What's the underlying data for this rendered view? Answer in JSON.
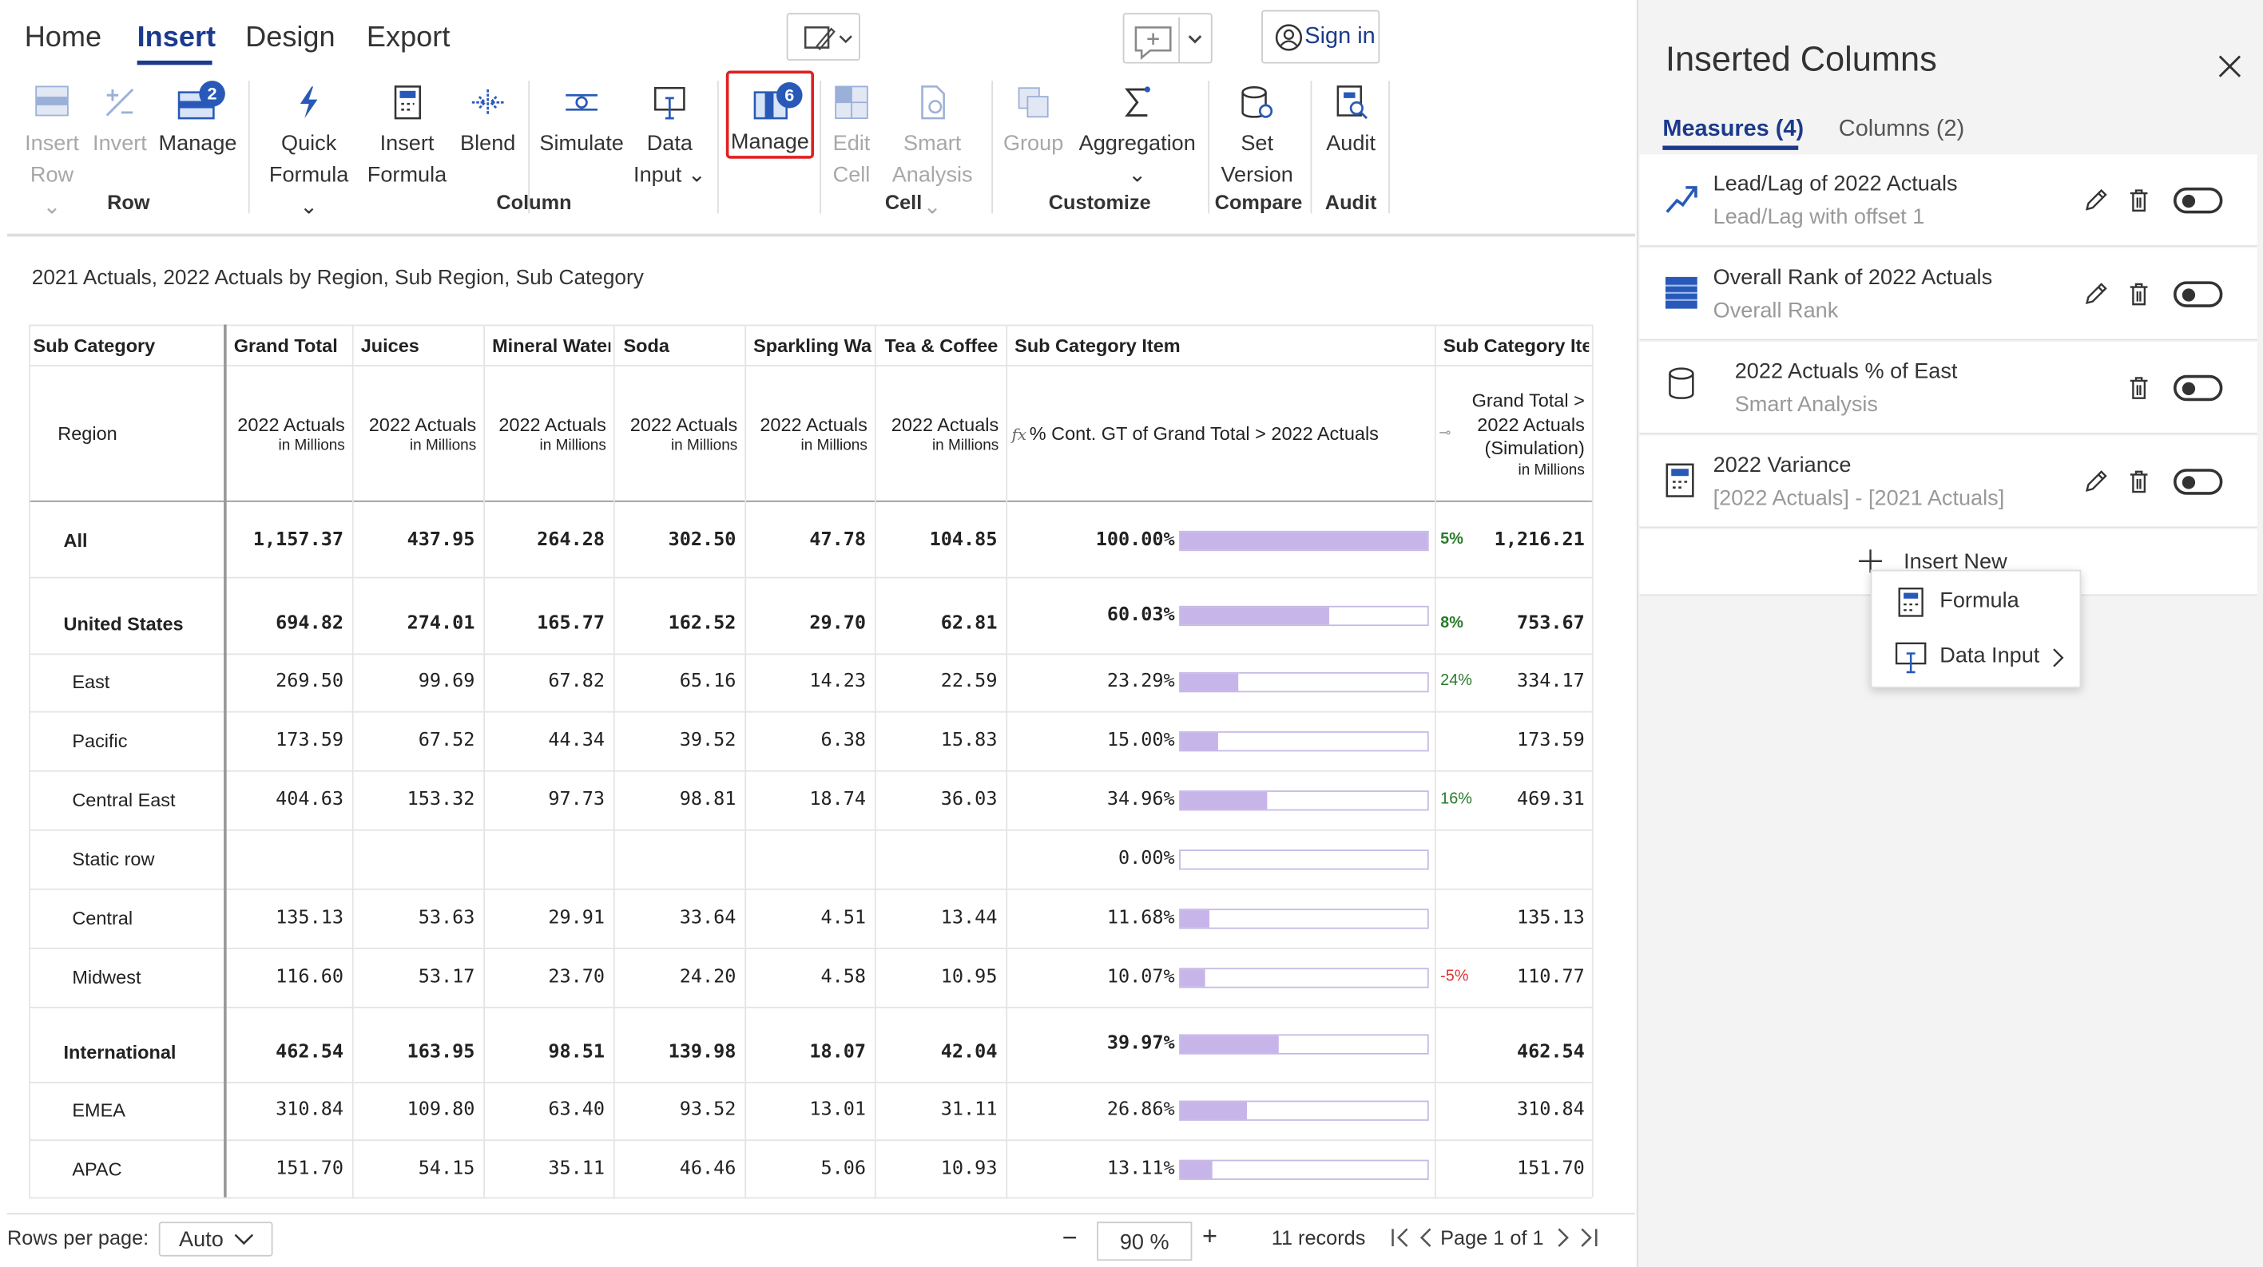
{
  "tabs": [
    "Home",
    "Insert",
    "Design",
    "Export"
  ],
  "sign_in": "Sign in",
  "ribbon": {
    "insert_row": [
      "Insert",
      "Row"
    ],
    "invert": "Invert",
    "manage_row": "Manage",
    "manage_row_badge": "2",
    "quick_formula": [
      "Quick",
      "Formula"
    ],
    "insert_formula": [
      "Insert",
      "Formula"
    ],
    "blend": "Blend",
    "simulate": "Simulate",
    "data_input": [
      "Data",
      "Input"
    ],
    "manage_col": "Manage",
    "manage_col_badge": "6",
    "edit_cell": [
      "Edit",
      "Cell"
    ],
    "smart_analysis": [
      "Smart",
      "Analysis"
    ],
    "group": "Group",
    "aggregation": "Aggregation",
    "set_version": [
      "Set",
      "Version"
    ],
    "audit": "Audit",
    "groups": {
      "row": "Row",
      "column": "Column",
      "cell": "Cell",
      "customize": "Customize",
      "compare": "Compare",
      "audit": "Audit"
    }
  },
  "report_title": "2021 Actuals, 2022 Actuals by Region, Sub Region, Sub Category",
  "table": {
    "col_headers": [
      "Sub Category",
      "Grand Total",
      "Juices",
      "Mineral Water",
      "Soda",
      "Sparkling Wat",
      "Tea & Coffee",
      "Sub Category Item",
      "Sub Category Ite"
    ],
    "region_label": "Region",
    "measure": "2022 Actuals",
    "unit": "in Millions",
    "pct_header": "% Cont. GT of Grand Total > 2022 Actuals",
    "sim_header": [
      "Grand Total >",
      "2022 Actuals",
      "(Simulation)",
      "in Millions"
    ],
    "rows": [
      {
        "label": "All",
        "bold": true,
        "v": [
          "1,157.37",
          "437.95",
          "264.28",
          "302.50",
          "47.78",
          "104.85"
        ],
        "pct": "100.00%",
        "fill": 1.0,
        "delta": "5%",
        "dc": "#2a7a2a",
        "sim": "1,216.21"
      },
      {
        "label": "United States",
        "bold": true,
        "v": [
          "694.82",
          "274.01",
          "165.77",
          "162.52",
          "29.70",
          "62.81"
        ],
        "pct": "60.03%",
        "fill": 0.6003,
        "delta": "8%",
        "dc": "#2a7a2a",
        "sim": "753.67"
      },
      {
        "label": "East",
        "bold": false,
        "v": [
          "269.50",
          "99.69",
          "67.82",
          "65.16",
          "14.23",
          "22.59"
        ],
        "pct": "23.29%",
        "fill": 0.2329,
        "delta": "24%",
        "dc": "#2a7a2a",
        "sim": "334.17"
      },
      {
        "label": "Pacific",
        "bold": false,
        "v": [
          "173.59",
          "67.52",
          "44.34",
          "39.52",
          "6.38",
          "15.83"
        ],
        "pct": "15.00%",
        "fill": 0.15,
        "delta": "",
        "dc": "",
        "sim": "173.59"
      },
      {
        "label": "Central East",
        "bold": false,
        "v": [
          "404.63",
          "153.32",
          "97.73",
          "98.81",
          "18.74",
          "36.03"
        ],
        "pct": "34.96%",
        "fill": 0.3496,
        "delta": "16%",
        "dc": "#2a7a2a",
        "sim": "469.31"
      },
      {
        "label": "Static row",
        "bold": false,
        "v": [
          "",
          "",
          "",
          "",
          "",
          ""
        ],
        "pct": "0.00%",
        "fill": 0,
        "delta": "",
        "dc": "",
        "sim": ""
      },
      {
        "label": "Central",
        "bold": false,
        "v": [
          "135.13",
          "53.63",
          "29.91",
          "33.64",
          "4.51",
          "13.44"
        ],
        "pct": "11.68%",
        "fill": 0.1168,
        "delta": "",
        "dc": "",
        "sim": "135.13"
      },
      {
        "label": "Midwest",
        "bold": false,
        "v": [
          "116.60",
          "53.17",
          "23.70",
          "24.20",
          "4.58",
          "10.95"
        ],
        "pct": "10.07%",
        "fill": 0.1007,
        "delta": "-5%",
        "dc": "#d33",
        "sim": "110.77"
      },
      {
        "label": "International",
        "bold": true,
        "v": [
          "462.54",
          "163.95",
          "98.51",
          "139.98",
          "18.07",
          "42.04"
        ],
        "pct": "39.97%",
        "fill": 0.3997,
        "delta": "",
        "dc": "",
        "sim": "462.54"
      },
      {
        "label": "EMEA",
        "bold": false,
        "v": [
          "310.84",
          "109.80",
          "63.40",
          "93.52",
          "13.01",
          "31.11"
        ],
        "pct": "26.86%",
        "fill": 0.2686,
        "delta": "",
        "dc": "",
        "sim": "310.84"
      },
      {
        "label": "APAC",
        "bold": false,
        "v": [
          "151.70",
          "54.15",
          "35.11",
          "46.46",
          "5.06",
          "10.93"
        ],
        "pct": "13.11%",
        "fill": 0.1311,
        "delta": "",
        "dc": "",
        "sim": "151.70"
      }
    ]
  },
  "footer": {
    "rows_per_page": "Rows per page:",
    "rows_value": "Auto",
    "zoom": "90 %",
    "records": "11 records",
    "page": "Page",
    "page_num": "1",
    "of": "of 1"
  },
  "panel": {
    "title": "Inserted Columns",
    "tabs": [
      "Measures (4)",
      "Columns (2)"
    ],
    "items": [
      {
        "title": "Lead/Lag of 2022 Actuals",
        "sub": "Lead/Lag with offset 1"
      },
      {
        "title": "Overall Rank of 2022 Actuals",
        "sub": "Overall Rank"
      },
      {
        "title": "2022 Actuals % of East",
        "sub": "Smart Analysis"
      },
      {
        "title": "2022 Variance",
        "sub": "[2022 Actuals] - [2021 Actuals]"
      }
    ],
    "insert_new": "Insert New",
    "menu": [
      "Formula",
      "Data Input"
    ]
  }
}
